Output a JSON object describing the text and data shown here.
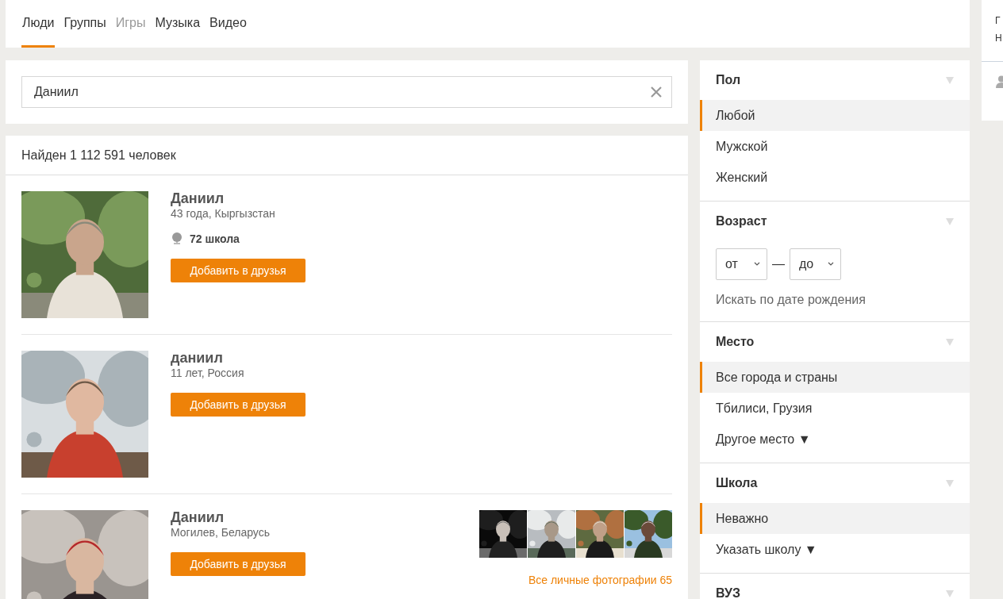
{
  "tabs": [
    {
      "label": "Люди",
      "selected": true,
      "disabled": false
    },
    {
      "label": "Группы",
      "selected": false,
      "disabled": false
    },
    {
      "label": "Игры",
      "selected": false,
      "disabled": true
    },
    {
      "label": "Музыка",
      "selected": false,
      "disabled": false
    },
    {
      "label": "Видео",
      "selected": false,
      "disabled": false
    }
  ],
  "side_card": {
    "lines": [
      "Г",
      "Н"
    ]
  },
  "search": {
    "value": "Даниил"
  },
  "results": {
    "summary": "Найден 1 112 591 человек",
    "people": [
      {
        "name": "Даниил",
        "info": "43 года, Кыргызстан",
        "school": "72 школа",
        "button": "Добавить в друзья"
      },
      {
        "name": "даниил",
        "info": "11 лет, Россия",
        "button": "Добавить в друзья"
      },
      {
        "name": "Даниил",
        "info": "Могилев, Беларусь",
        "button": "Добавить в друзья",
        "photos_link": "Все личные фотографии 65"
      }
    ]
  },
  "filters": [
    {
      "kind": "options",
      "title": "Пол",
      "options": [
        {
          "label": "Любой",
          "selected": true
        },
        {
          "label": "Мужской",
          "selected": false
        },
        {
          "label": "Женский",
          "selected": false
        }
      ]
    },
    {
      "kind": "age",
      "title": "Возраст",
      "from": "от",
      "separator": "—",
      "to": "до",
      "link": "Искать по дате рождения"
    },
    {
      "kind": "options",
      "title": "Место",
      "options": [
        {
          "label": "Все города и страны",
          "selected": true
        },
        {
          "label": "Тбилиси, Грузия",
          "selected": false
        },
        {
          "label": "Другое место ▼",
          "selected": false
        }
      ]
    },
    {
      "kind": "options",
      "title": "Школа",
      "options": [
        {
          "label": "Неважно",
          "selected": true
        },
        {
          "label": "Указать школу ▼",
          "selected": false
        }
      ]
    },
    {
      "kind": "options",
      "title": "ВУЗ"
    }
  ]
}
